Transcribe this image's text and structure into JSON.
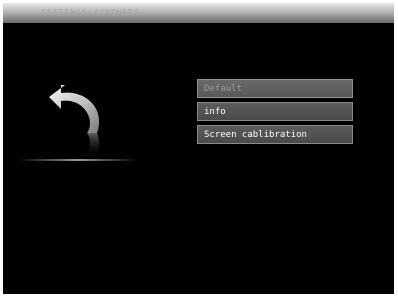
{
  "window": {
    "title": "SETTINGS://OTHERS"
  },
  "back": {
    "icon": "back-arrow-icon"
  },
  "menu": {
    "items": [
      {
        "label": "Default",
        "enabled": false
      },
      {
        "label": "info",
        "enabled": true
      },
      {
        "label": "Screen cablibration",
        "enabled": true
      }
    ]
  },
  "colors": {
    "background": "#000000",
    "button": "#4f4f4f",
    "button_border": "#8a8a8a",
    "text": "#ffffff",
    "disabled_text": "#9c9c9c"
  }
}
